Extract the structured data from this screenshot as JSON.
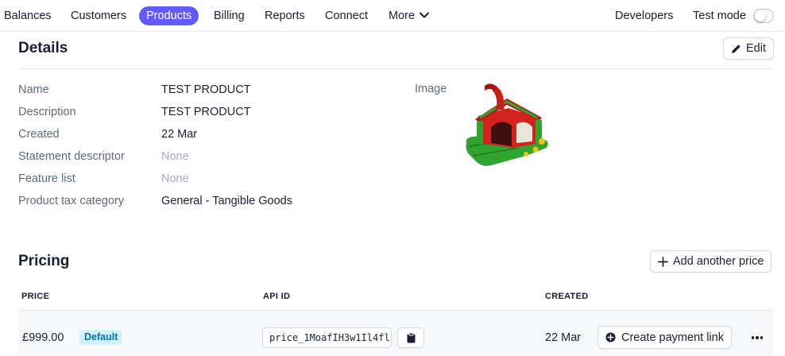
{
  "nav": {
    "items": [
      {
        "label": "Balances"
      },
      {
        "label": "Customers"
      },
      {
        "label": "Products",
        "active": true
      },
      {
        "label": "Billing"
      },
      {
        "label": "Reports"
      },
      {
        "label": "Connect"
      },
      {
        "label": "More"
      }
    ],
    "developers": "Developers",
    "test_mode": "Test mode",
    "test_mode_on": false
  },
  "details": {
    "title": "Details",
    "edit_label": "Edit",
    "fields": [
      {
        "label": "Name",
        "value": "TEST PRODUCT"
      },
      {
        "label": "Description",
        "value": "TEST PRODUCT"
      },
      {
        "label": "Created",
        "value": "22 Mar"
      },
      {
        "label": "Statement descriptor",
        "value": "None"
      },
      {
        "label": "Feature list",
        "value": "None"
      },
      {
        "label": "Product tax category",
        "value": "General - Tangible Goods"
      }
    ],
    "image_label": "Image"
  },
  "pricing": {
    "title": "Pricing",
    "add_price_label": "Add another price",
    "columns": [
      "PRICE",
      "API ID",
      "CREATED"
    ],
    "rows": [
      {
        "price": "£999.00",
        "badge": "Default",
        "api_id": "price_1MoafIH3w1Il4fl",
        "created": "22 Mar",
        "payment_link_label": "Create payment link"
      }
    ]
  },
  "colors": {
    "accent": "#635bff",
    "text": "#1a1f36",
    "muted": "#5f6b7a",
    "badge_bg": "#d1f3fe",
    "badge_text": "#0570b8"
  }
}
